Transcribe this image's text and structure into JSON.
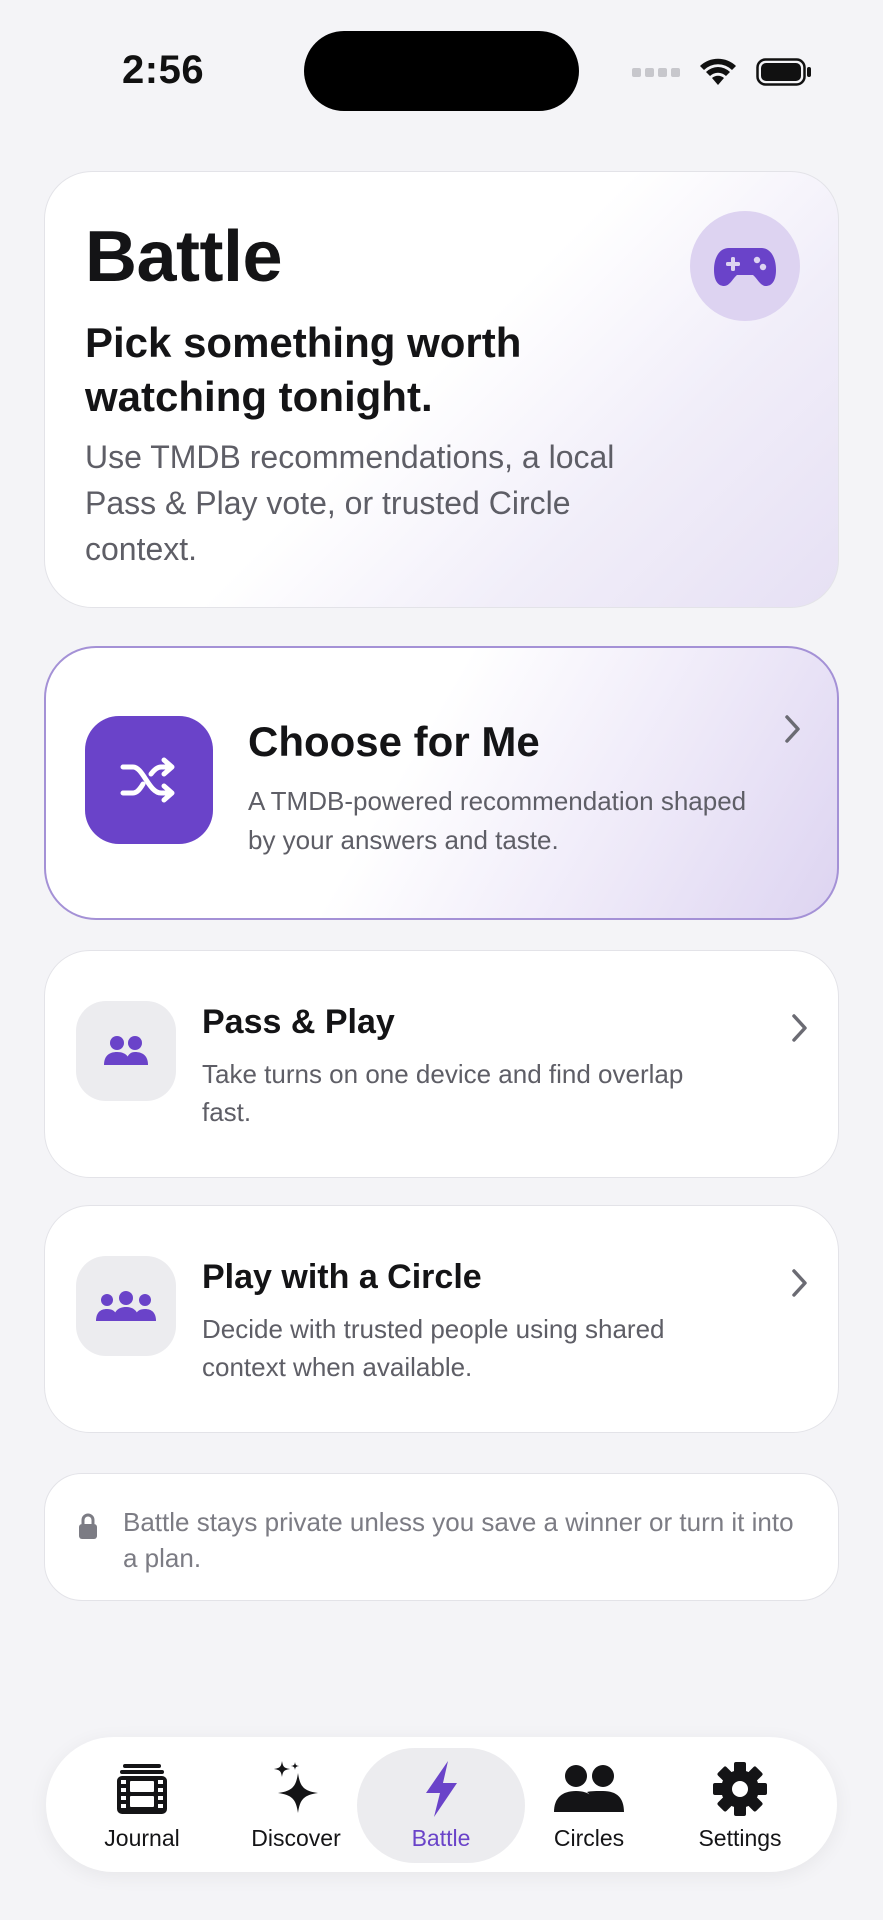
{
  "status_bar": {
    "time": "2:56"
  },
  "hero": {
    "title": "Battle",
    "subtitle": "Pick something worth watching tonight.",
    "description": "Use TMDB recommendations, a local Pass & Play vote, or trusted Circle context.",
    "icon": "gamecontroller-icon"
  },
  "choose": {
    "title": "Choose for Me",
    "description": "A TMDB-powered recommendation shaped by your answers and taste.",
    "icon": "shuffle-icon"
  },
  "options": [
    {
      "title": "Pass & Play",
      "description": "Take turns on one device and find overlap fast.",
      "icon": "two-people-icon"
    },
    {
      "title": "Play with a Circle",
      "description": "Decide with trusted people using shared context when available.",
      "icon": "three-people-icon"
    }
  ],
  "privacy_note": {
    "text": "Battle stays private unless you save a winner or turn it into a plan.",
    "icon": "lock-icon"
  },
  "tabs": [
    {
      "label": "Journal",
      "icon": "film-stack-icon"
    },
    {
      "label": "Discover",
      "icon": "sparkles-icon"
    },
    {
      "label": "Battle",
      "icon": "bolt-icon",
      "active": true
    },
    {
      "label": "Circles",
      "icon": "people-icon"
    },
    {
      "label": "Settings",
      "icon": "gear-icon"
    }
  ],
  "colors": {
    "accent": "#6a43c9",
    "background": "#f4f4f7",
    "card": "#ffffff",
    "secondary_text": "#5e5e66"
  }
}
